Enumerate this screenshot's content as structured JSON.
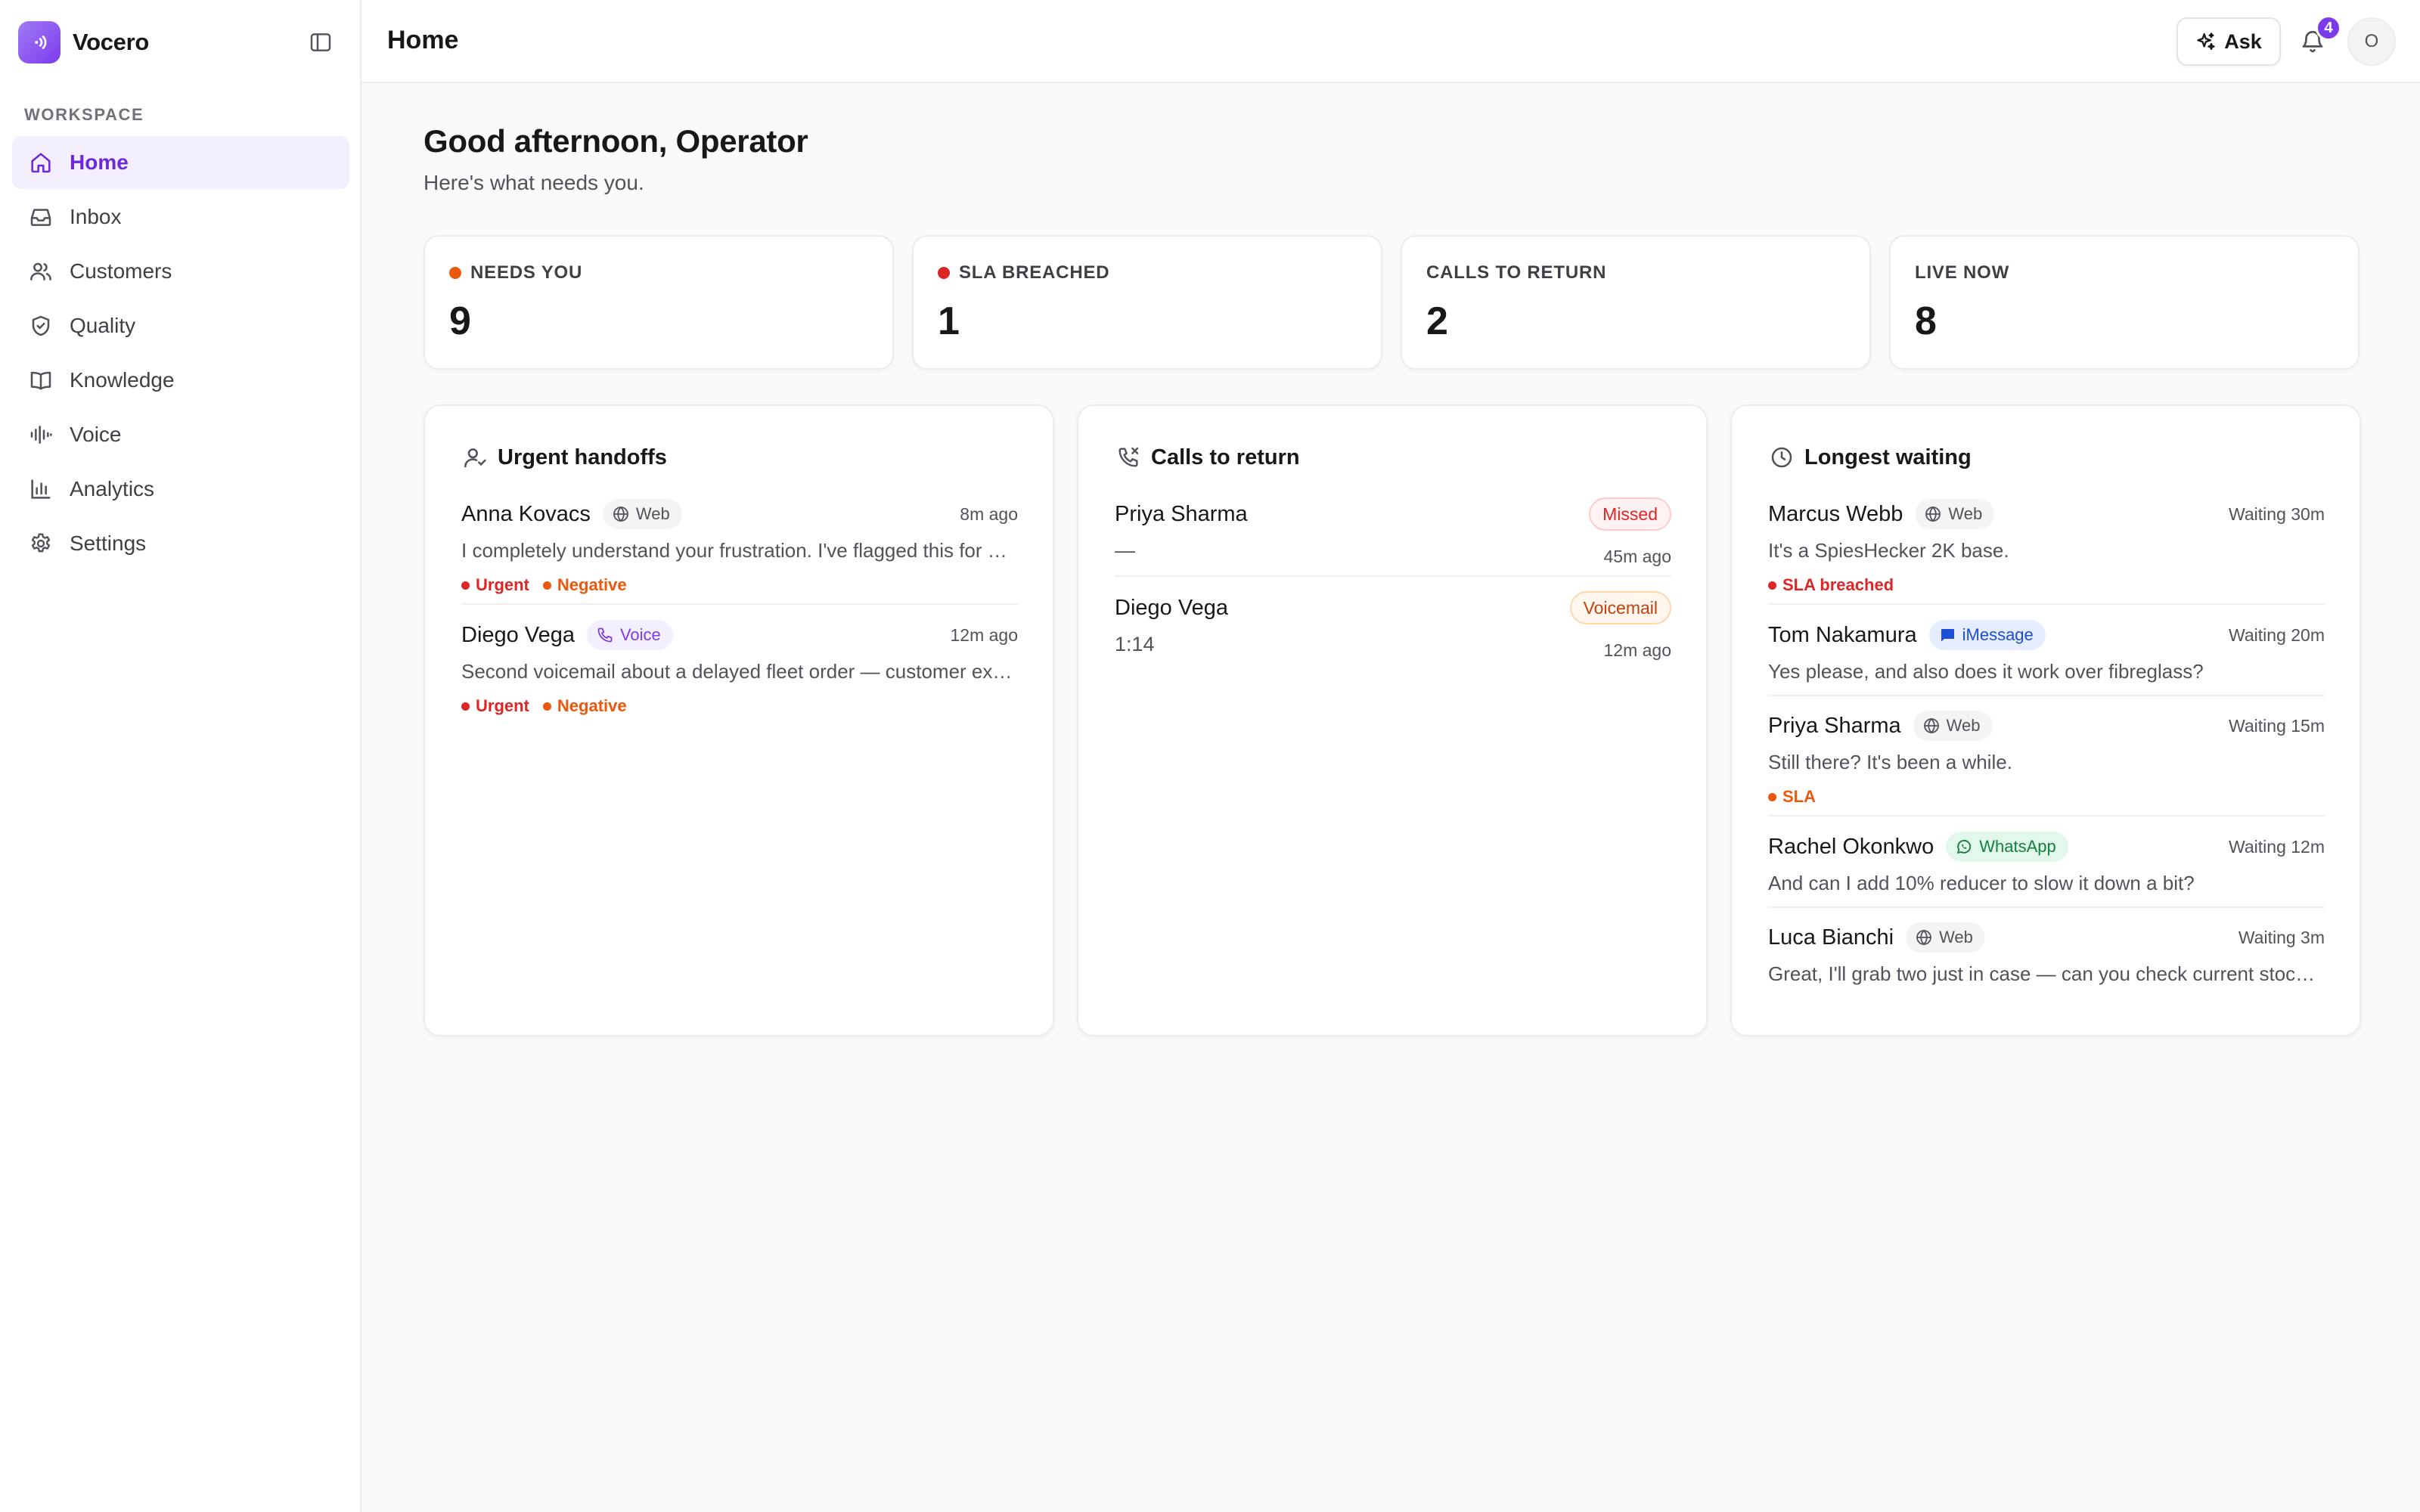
{
  "brand": {
    "name": "Vocero",
    "accent": "#7c3aed"
  },
  "sidebar": {
    "section_label": "WORKSPACE",
    "items": [
      {
        "label": "Home",
        "icon": "home-icon",
        "active": true
      },
      {
        "label": "Inbox",
        "icon": "inbox-icon"
      },
      {
        "label": "Customers",
        "icon": "users-icon"
      },
      {
        "label": "Quality",
        "icon": "shield-check-icon"
      },
      {
        "label": "Knowledge",
        "icon": "book-open-icon"
      },
      {
        "label": "Voice",
        "icon": "audio-waveform-icon"
      },
      {
        "label": "Analytics",
        "icon": "bar-chart-icon"
      },
      {
        "label": "Settings",
        "icon": "gear-icon"
      }
    ]
  },
  "header": {
    "title": "Home",
    "ask_label": "Ask",
    "notification_count": "4",
    "avatar_initial": "O"
  },
  "main": {
    "greeting": "Good afternoon, Operator",
    "subgreeting": "Here's what needs you.",
    "stats": [
      {
        "label": "NEEDS YOU",
        "value": "9",
        "dot_color": "#ea580c"
      },
      {
        "label": "SLA BREACHED",
        "value": "1",
        "dot_color": "#dc2626"
      },
      {
        "label": "CALLS TO RETURN",
        "value": "2"
      },
      {
        "label": "LIVE NOW",
        "value": "8"
      }
    ],
    "urgent_handoffs": {
      "title": "Urgent handoffs",
      "items": [
        {
          "name": "Anna Kovacs",
          "channel": "Web",
          "time": "8m ago",
          "message": "I completely understand your frustration. I've flagged this for a supervisor to review right away.",
          "tags": [
            "Urgent",
            "Negative"
          ]
        },
        {
          "name": "Diego Vega",
          "channel": "Voice",
          "time": "12m ago",
          "message": "Second voicemail about a delayed fleet order — customer expects a callback today.",
          "tags": [
            "Urgent",
            "Negative"
          ]
        }
      ]
    },
    "calls_to_return": {
      "title": "Calls to return",
      "items": [
        {
          "name": "Priya Sharma",
          "status": "Missed",
          "detail": "—",
          "time": "45m ago"
        },
        {
          "name": "Diego Vega",
          "status": "Voicemail",
          "detail": "1:14",
          "time": "12m ago"
        }
      ]
    },
    "longest_waiting": {
      "title": "Longest waiting",
      "items": [
        {
          "name": "Marcus Webb",
          "channel": "Web",
          "wait": "Waiting 30m",
          "message": "It's a SpiesHecker 2K base.",
          "tag": "SLA breached",
          "tag_color": "red"
        },
        {
          "name": "Tom Nakamura",
          "channel": "iMessage",
          "wait": "Waiting 20m",
          "message": "Yes please, and also does it work over fibreglass?"
        },
        {
          "name": "Priya Sharma",
          "channel": "Web",
          "wait": "Waiting 15m",
          "message": "Still there? It's been a while.",
          "tag": "SLA",
          "tag_color": "orange"
        },
        {
          "name": "Rachel Okonkwo",
          "channel": "WhatsApp",
          "wait": "Waiting 12m",
          "message": "And can I add 10% reducer to slow it down a bit?"
        },
        {
          "name": "Luca Bianchi",
          "channel": "Web",
          "wait": "Waiting 3m",
          "message": "Great, I'll grab two just in case — can you check current stock levels?"
        }
      ]
    }
  }
}
